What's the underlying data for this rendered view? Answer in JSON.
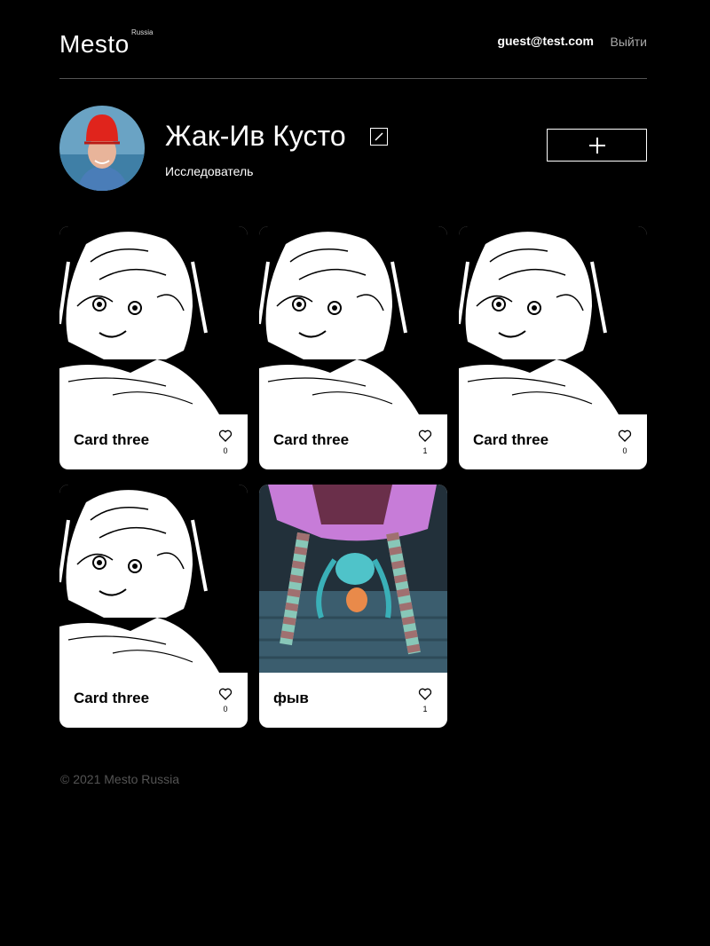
{
  "header": {
    "logo": "Mesto",
    "logo_sub": "Russia",
    "email": "guest@test.com",
    "logout_label": "Выйти"
  },
  "profile": {
    "name": "Жак-Ив Кусто",
    "about": "Исследователь",
    "edit_icon": "pencil-icon",
    "add_icon": "plus-icon"
  },
  "cards": [
    {
      "title": "Card three",
      "likes": "0",
      "image": "manga-girl"
    },
    {
      "title": "Card three",
      "likes": "1",
      "image": "manga-girl"
    },
    {
      "title": "Card three",
      "likes": "0",
      "image": "manga-girl"
    },
    {
      "title": "Card three",
      "likes": "0",
      "image": "manga-girl"
    },
    {
      "title": "фыв",
      "likes": "1",
      "image": "anime-upside-down"
    }
  ],
  "footer": {
    "copyright": "© 2021 Mesto Russia"
  },
  "colors": {
    "background": "#000000",
    "card": "#ffffff",
    "divider": "#545454",
    "muted": "#a9a9a9"
  }
}
